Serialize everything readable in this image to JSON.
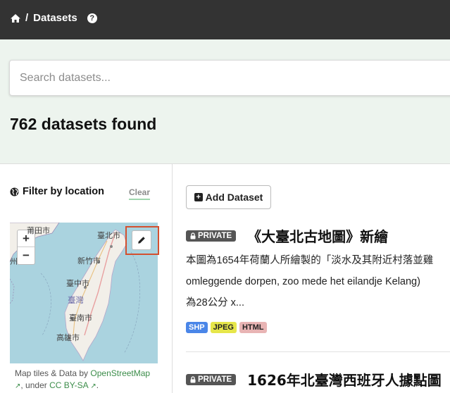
{
  "header": {
    "breadcrumb": "Datasets",
    "help_icon": "question-circle-icon"
  },
  "search": {
    "placeholder": "Search datasets..."
  },
  "results": {
    "count_text": "762 datasets found"
  },
  "filter": {
    "title": "Filter by location",
    "clear_label": "Clear",
    "map": {
      "zoom_in": "+",
      "zoom_out": "−",
      "places": [
        "莆田市",
        "臺北市",
        "新竹市",
        "臺中市",
        "臺灣",
        "臺南市",
        "高雄市",
        "州"
      ],
      "attribution": {
        "prefix": "Map tiles & Data by ",
        "osm_link": "OpenStreetMap",
        "middle": ", under ",
        "license_link": "CC BY-SA",
        "suffix": "."
      }
    }
  },
  "actions": {
    "add_dataset": "Add Dataset"
  },
  "datasets": [
    {
      "badge": "PRIVATE",
      "title": "《大臺北古地圖》新繪",
      "description_lines": [
        "本圖為1654年荷蘭人所繪製的「淡水及其附近村落並雞",
        "omleggende dorpen, zoo mede het eilandje Kelang)",
        "為28公分 x..."
      ],
      "formats": [
        "SHP",
        "JPEG",
        "HTML"
      ]
    },
    {
      "badge": "PRIVATE",
      "title": "1626年北臺灣西班牙人據點圖"
    }
  ],
  "colors": {
    "topbar": "#333333",
    "hero_bg": "#edf4ee",
    "edit_highlight": "#d4502f",
    "link_green": "#3c8d4a"
  }
}
